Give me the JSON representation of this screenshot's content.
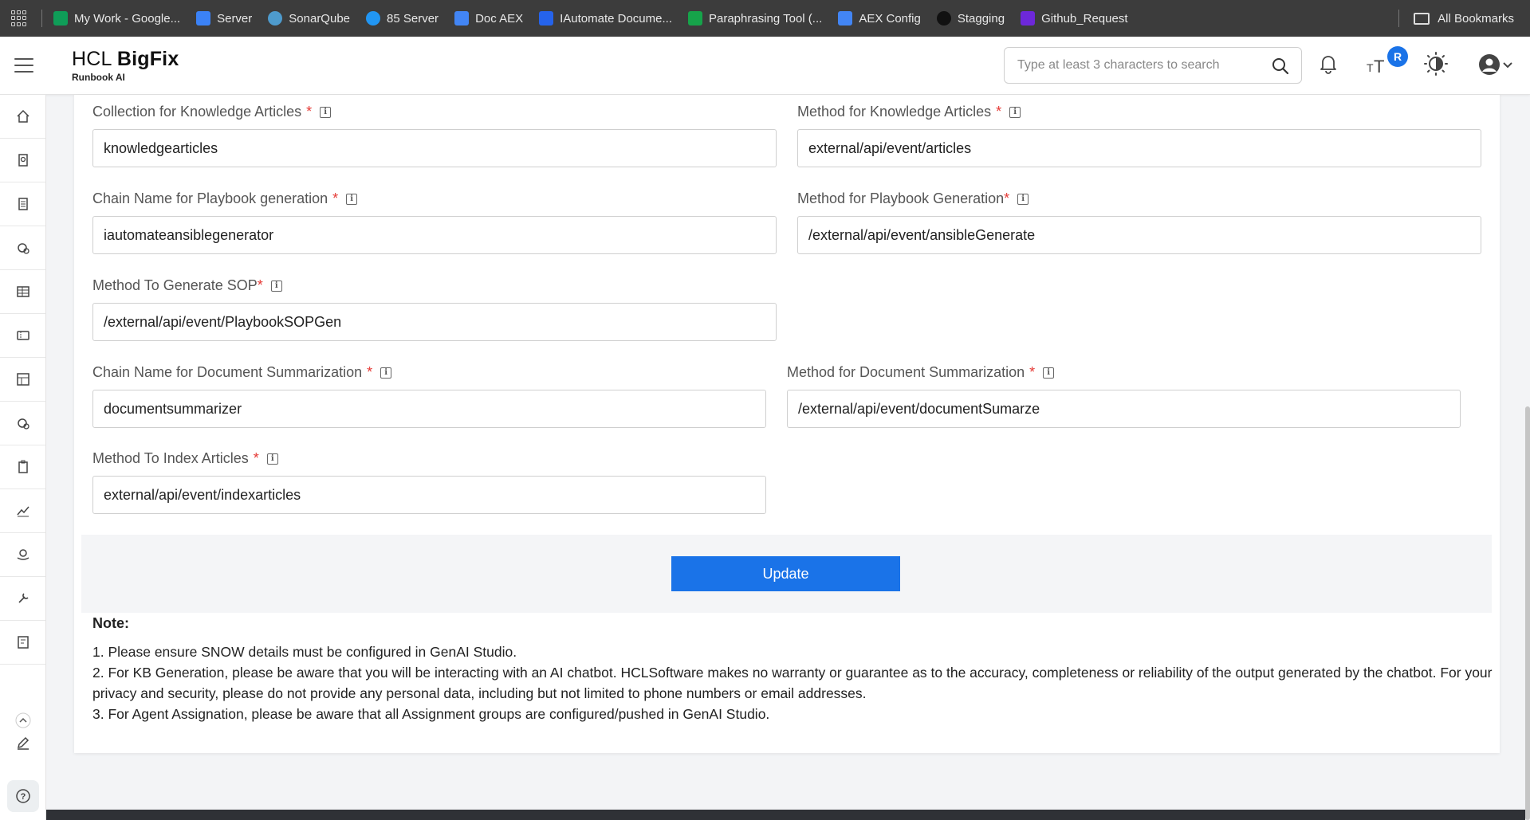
{
  "bookmarks": {
    "items": [
      {
        "label": "My Work - Google...",
        "icon": "google-sheets-icon",
        "color": "#0f9d58"
      },
      {
        "label": "Server",
        "icon": "mc-icon",
        "color": "#3b82f6"
      },
      {
        "label": "SonarQube",
        "icon": "sonarqube-icon",
        "color": "#4e9bcd"
      },
      {
        "label": "85 Server",
        "icon": "server-icon",
        "color": "#2196f3"
      },
      {
        "label": "Doc AEX",
        "icon": "google-docs-icon",
        "color": "#4285f4"
      },
      {
        "label": "IAutomate Docume...",
        "icon": "confluence-icon",
        "color": "#2563eb"
      },
      {
        "label": "Paraphrasing Tool (...",
        "icon": "quillbot-icon",
        "color": "#16a34a"
      },
      {
        "label": "AEX Config",
        "icon": "google-docs-icon",
        "color": "#4285f4"
      },
      {
        "label": "Stagging",
        "icon": "stagging-icon",
        "color": "#111111"
      },
      {
        "label": "Github_Request",
        "icon": "github-request-icon",
        "color": "#6d28d9"
      }
    ],
    "all_bookmarks": "All Bookmarks"
  },
  "header": {
    "brand_prefix": "HCL ",
    "brand_bold": "BigFix",
    "brand_sub": "Runbook AI",
    "search_placeholder": "Type at least 3 characters to search",
    "badge": "R"
  },
  "form": {
    "collection_ka": {
      "label": "Collection for Knowledge Articles",
      "value": "knowledgearticles"
    },
    "method_ka": {
      "label": "Method for Knowledge Articles",
      "value": "external/api/event/articles"
    },
    "chain_playbook": {
      "label": "Chain Name for Playbook generation",
      "value": "iautomateansiblegenerator"
    },
    "method_playbook": {
      "label": "Method for Playbook Generation",
      "value": "/external/api/event/ansibleGenerate"
    },
    "method_sop": {
      "label": "Method To Generate SOP",
      "value": "/external/api/event/PlaybookSOPGen"
    },
    "chain_docsum": {
      "label": "Chain Name for Document Summarization",
      "value": "documentsummarizer"
    },
    "method_docsum": {
      "label": "Method for Document Summarization",
      "value": "/external/api/event/documentSumarze"
    },
    "method_index": {
      "label": "Method To Index Articles",
      "value": "external/api/event/indexarticles"
    },
    "required_mark": "*",
    "update_label": "Update"
  },
  "note": {
    "title": "Note:",
    "lines": [
      "1. Please ensure SNOW details must be configured in GenAI Studio.",
      "2. For KB Generation, please be aware that you will be interacting with an AI chatbot. HCLSoftware makes no warranty or guarantee as to the accuracy, completeness or reliability of the output generated by the chatbot. For your privacy and security, please do not provide any personal data, including but not limited to phone numbers or email addresses.",
      "3. For Agent Assignation, please be aware that all Assignment groups are configured/pushed in GenAI Studio."
    ]
  },
  "sidebar": {
    "icons": [
      "home-icon",
      "knowledge-icon",
      "document-icon",
      "automation-settings-icon",
      "table-icon",
      "ticket-icon",
      "dashboard-icon",
      "settings-cog-icon",
      "clipboard-icon",
      "analytics-chart-icon",
      "hand-coins-icon",
      "tools-icon",
      "report-icon"
    ]
  },
  "colors": {
    "primary": "#1a73e8",
    "required": "#e53935",
    "topbar": "#3c3c3c"
  }
}
